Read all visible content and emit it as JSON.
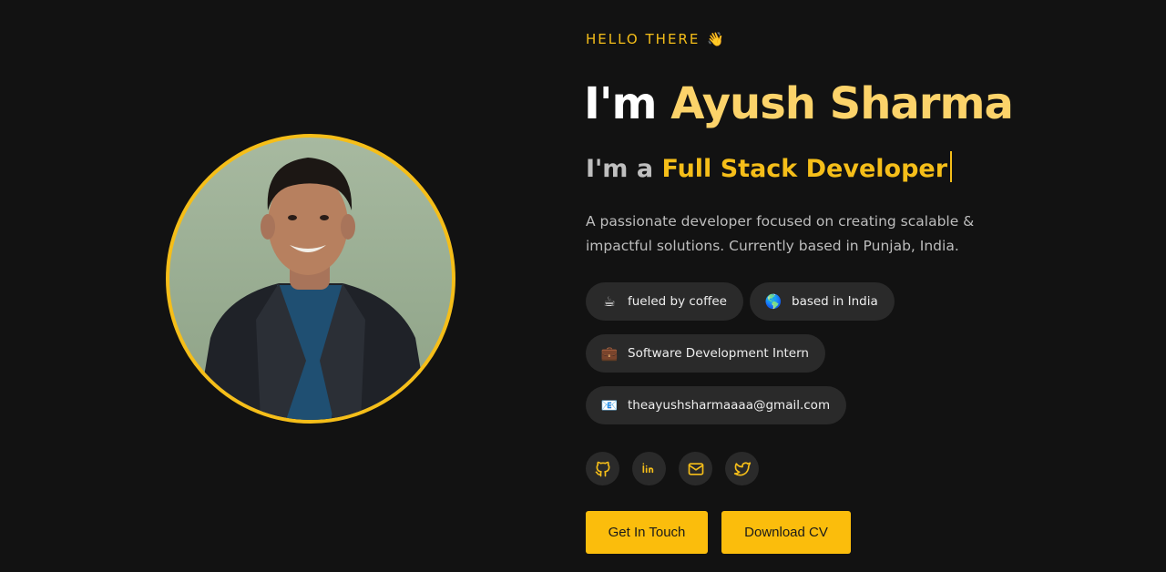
{
  "hero": {
    "greeting": "HELLO THERE",
    "greeting_emoji": "👋",
    "name_prefix": "I'm",
    "name": "Ayush Sharma",
    "role_prefix": "I'm a",
    "role": "Full Stack Developer",
    "bio": "A passionate developer focused on creating scalable & impactful solutions. Currently based in Punjab, India."
  },
  "chips": [
    {
      "icon": "coffee-icon",
      "emoji": "☕",
      "label": "fueled by coffee"
    },
    {
      "icon": "globe-icon",
      "emoji": "🌎",
      "label": "based in India"
    },
    {
      "icon": "briefcase-icon",
      "emoji": "💼",
      "label": "Software Development Intern"
    },
    {
      "icon": "email-icon",
      "emoji": "📧",
      "label": "theayushsharmaaaa@gmail.com"
    }
  ],
  "social": [
    {
      "icon": "github-icon"
    },
    {
      "icon": "linkedin-icon"
    },
    {
      "icon": "mail-icon"
    },
    {
      "icon": "twitter-icon"
    }
  ],
  "buttons": {
    "contact": "Get In Touch",
    "cv": "Download CV"
  },
  "colors": {
    "background": "#121212",
    "accent": "#f5be19",
    "chip_bg": "#2a2a2a",
    "button_bg": "#fbbd0c"
  }
}
